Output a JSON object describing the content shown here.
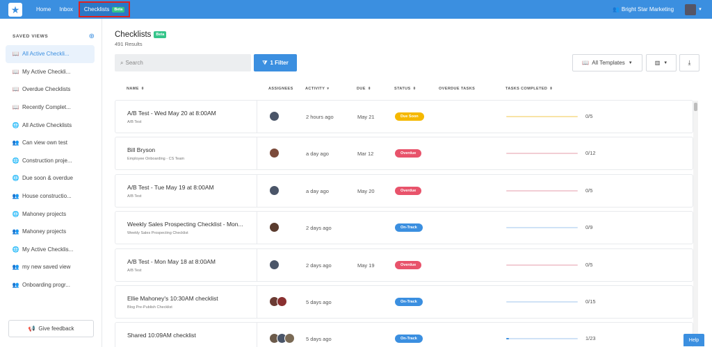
{
  "topbar": {
    "nav": [
      {
        "label": "Home"
      },
      {
        "label": "Inbox"
      },
      {
        "label": "Checklists",
        "badge": "Beta"
      }
    ],
    "org_name": "Bright Star Marketing",
    "brand_color": "#3b8fe0",
    "highlight_color": "#e0211f"
  },
  "sidebar": {
    "title": "SAVED VIEWS",
    "items": [
      {
        "label": "All Active Checkli...",
        "icon": "book-icon",
        "active": true
      },
      {
        "label": "My Active Checkli...",
        "icon": "book-icon"
      },
      {
        "label": "Overdue Checklists",
        "icon": "book-icon"
      },
      {
        "label": "Recently Complet...",
        "icon": "book-icon"
      },
      {
        "label": "All Active Checklists",
        "icon": "globe-icon"
      },
      {
        "label": "Can view own test",
        "icon": "users-icon"
      },
      {
        "label": "Construction proje...",
        "icon": "globe-icon"
      },
      {
        "label": "Due soon & overdue",
        "icon": "globe-icon"
      },
      {
        "label": "House constructio...",
        "icon": "users-icon"
      },
      {
        "label": "Mahoney projects",
        "icon": "globe-icon"
      },
      {
        "label": "Mahoney projects",
        "icon": "users-icon"
      },
      {
        "label": "My Active Checklis...",
        "icon": "globe-icon"
      },
      {
        "label": "my new saved view",
        "icon": "users-icon"
      },
      {
        "label": "Onboarding progr...",
        "icon": "users-icon"
      }
    ],
    "feedback_label": "Give feedback"
  },
  "main": {
    "title": "Checklists",
    "badge": "Beta",
    "results": "491 Results",
    "search_placeholder": "Search",
    "filter_label": "1 Filter",
    "templates_label": "All Templates",
    "help_label": "Help"
  },
  "table": {
    "headers": {
      "name": "NAME",
      "assignees": "ASSIGNEES",
      "activity": "ACTIVITY",
      "due": "DUE",
      "status": "STATUS",
      "overdue": "OVERDUE TASKS",
      "completed": "TASKS COMPLETED"
    },
    "rows": [
      {
        "name": "A/B Test - Wed May 20 at 8:00AM",
        "sub": "A/B Test",
        "activity": "2 hours ago",
        "due": "May 21",
        "status": "Due Soon",
        "status_color": "#f5b800",
        "progress": 0,
        "track_color": "#f8e3a6",
        "count": "0/5",
        "avatars": [
          "#4a5568"
        ]
      },
      {
        "name": "Bill Bryson",
        "sub": "Employee Onboarding - CS Team",
        "activity": "a day ago",
        "due": "Mar 12",
        "status": "Overdue",
        "status_color": "#e8536b",
        "progress": 0,
        "track_color": "#f2cdd4",
        "count": "0/12",
        "avatars": [
          "#7b4a3a"
        ]
      },
      {
        "name": "A/B Test - Tue May 19 at 8:00AM",
        "sub": "A/B Test",
        "activity": "a day ago",
        "due": "May 20",
        "status": "Overdue",
        "status_color": "#e8536b",
        "progress": 0,
        "track_color": "#f2cdd4",
        "count": "0/5",
        "avatars": [
          "#4a5568"
        ]
      },
      {
        "name": "Weekly Sales Prospecting Checklist - Mon...",
        "sub": "Weekly Sales Prospecting Checklist",
        "activity": "2 days ago",
        "due": "",
        "status": "On-Track",
        "status_color": "#3b8fe0",
        "progress": 0,
        "track_color": "#cfe2f6",
        "count": "0/9",
        "avatars": [
          "#5a3b2e"
        ]
      },
      {
        "name": "A/B Test - Mon May 18 at 8:00AM",
        "sub": "A/B Test",
        "activity": "2 days ago",
        "due": "May 19",
        "status": "Overdue",
        "status_color": "#e8536b",
        "progress": 0,
        "track_color": "#f2cdd4",
        "count": "0/5",
        "avatars": [
          "#4a5568"
        ]
      },
      {
        "name": "Ellie Mahoney's 10:30AM checklist",
        "sub": "Blog Pre-Publish Checklist",
        "activity": "5 days ago",
        "due": "",
        "status": "On-Track",
        "status_color": "#3b8fe0",
        "progress": 0,
        "track_color": "#cfe2f6",
        "count": "0/15",
        "avatars": [
          "#6b3b33",
          "#8a3030"
        ]
      },
      {
        "name": "Shared 10:09AM checklist",
        "sub": "",
        "activity": "5 days ago",
        "due": "",
        "status": "On-Track",
        "status_color": "#3b8fe0",
        "progress": 0.04,
        "track_color": "#cfe2f6",
        "count": "1/23",
        "avatars": [
          "#6b5a4a",
          "#4a5568",
          "#7a6a55"
        ]
      }
    ]
  }
}
